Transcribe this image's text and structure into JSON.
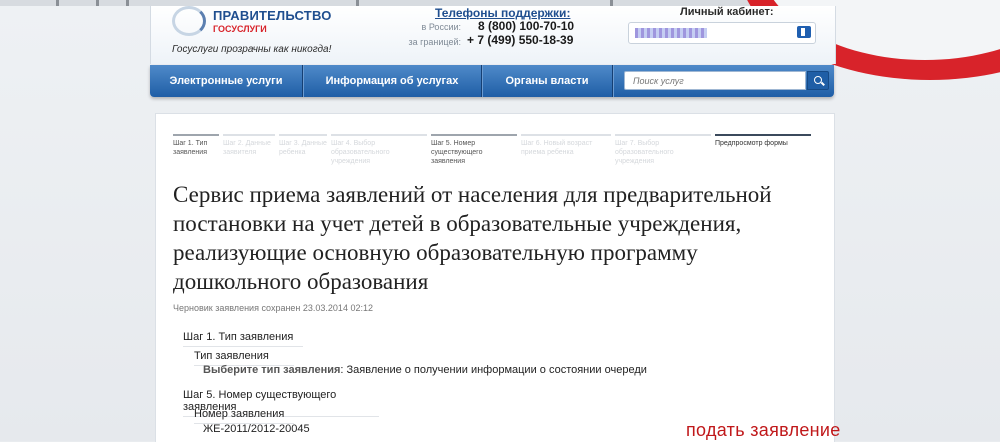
{
  "header": {
    "logo_title": "ПРАВИТЕЛЬСТВО",
    "logo_sub": "ГОСУСЛУГИ",
    "slogan": "Госуслуги прозрачны как никогда!",
    "support_title": "Телефоны поддержки:",
    "phones": [
      {
        "label": "в России:",
        "number": "8 (800) 100-70-10"
      },
      {
        "label": "за границей:",
        "number": "+ 7 (499) 550-18-39"
      }
    ],
    "cabinet_label": "Личный кабинет:"
  },
  "nav": {
    "items": [
      "Электронные услуги",
      "Информация об услугах",
      "Органы власти"
    ],
    "search_placeholder": "Поиск услуг"
  },
  "steps": [
    {
      "label": "Шаг 1. Тип заявления",
      "state": "active"
    },
    {
      "label": "Шаг 2. Данные заявителя",
      "state": "inactive"
    },
    {
      "label": "Шаг 3. Данные ребенка",
      "state": "inactive"
    },
    {
      "label": "Шаг 4. Выбор образовательного учреждения",
      "state": "inactive"
    },
    {
      "label": "Шаг 5. Номер существующего заявления",
      "state": "active"
    },
    {
      "label": "Шаг 6. Новый возраст приема ребенка",
      "state": "inactive"
    },
    {
      "label": "Шаг 7. Выбор образовательного учреждения",
      "state": "inactive"
    },
    {
      "label": "Предпросмотр формы",
      "state": "current"
    }
  ],
  "main": {
    "title": "Сервис приема заявлений от населения для предварительной постановки на учет детей в образовательные учреждения, реализующие основную образовательную программу дошкольного образования",
    "draft_note": "Черновик заявления сохранен 23.03.2014 02:12",
    "sections": [
      {
        "heading": "Шаг 1. Тип заявления",
        "field_label": "Тип заявления",
        "value_label": "Выберите тип заявления",
        "value_text": ": Заявление о получении информации о состоянии очереди"
      },
      {
        "heading": "Шаг 5. Номер существующего заявления",
        "field_label": "Номер заявления",
        "value_text": "ЖЕ-2011/2012-20045"
      }
    ]
  },
  "overlay": {
    "text": "подать заявление",
    "color": "#c0181a"
  }
}
